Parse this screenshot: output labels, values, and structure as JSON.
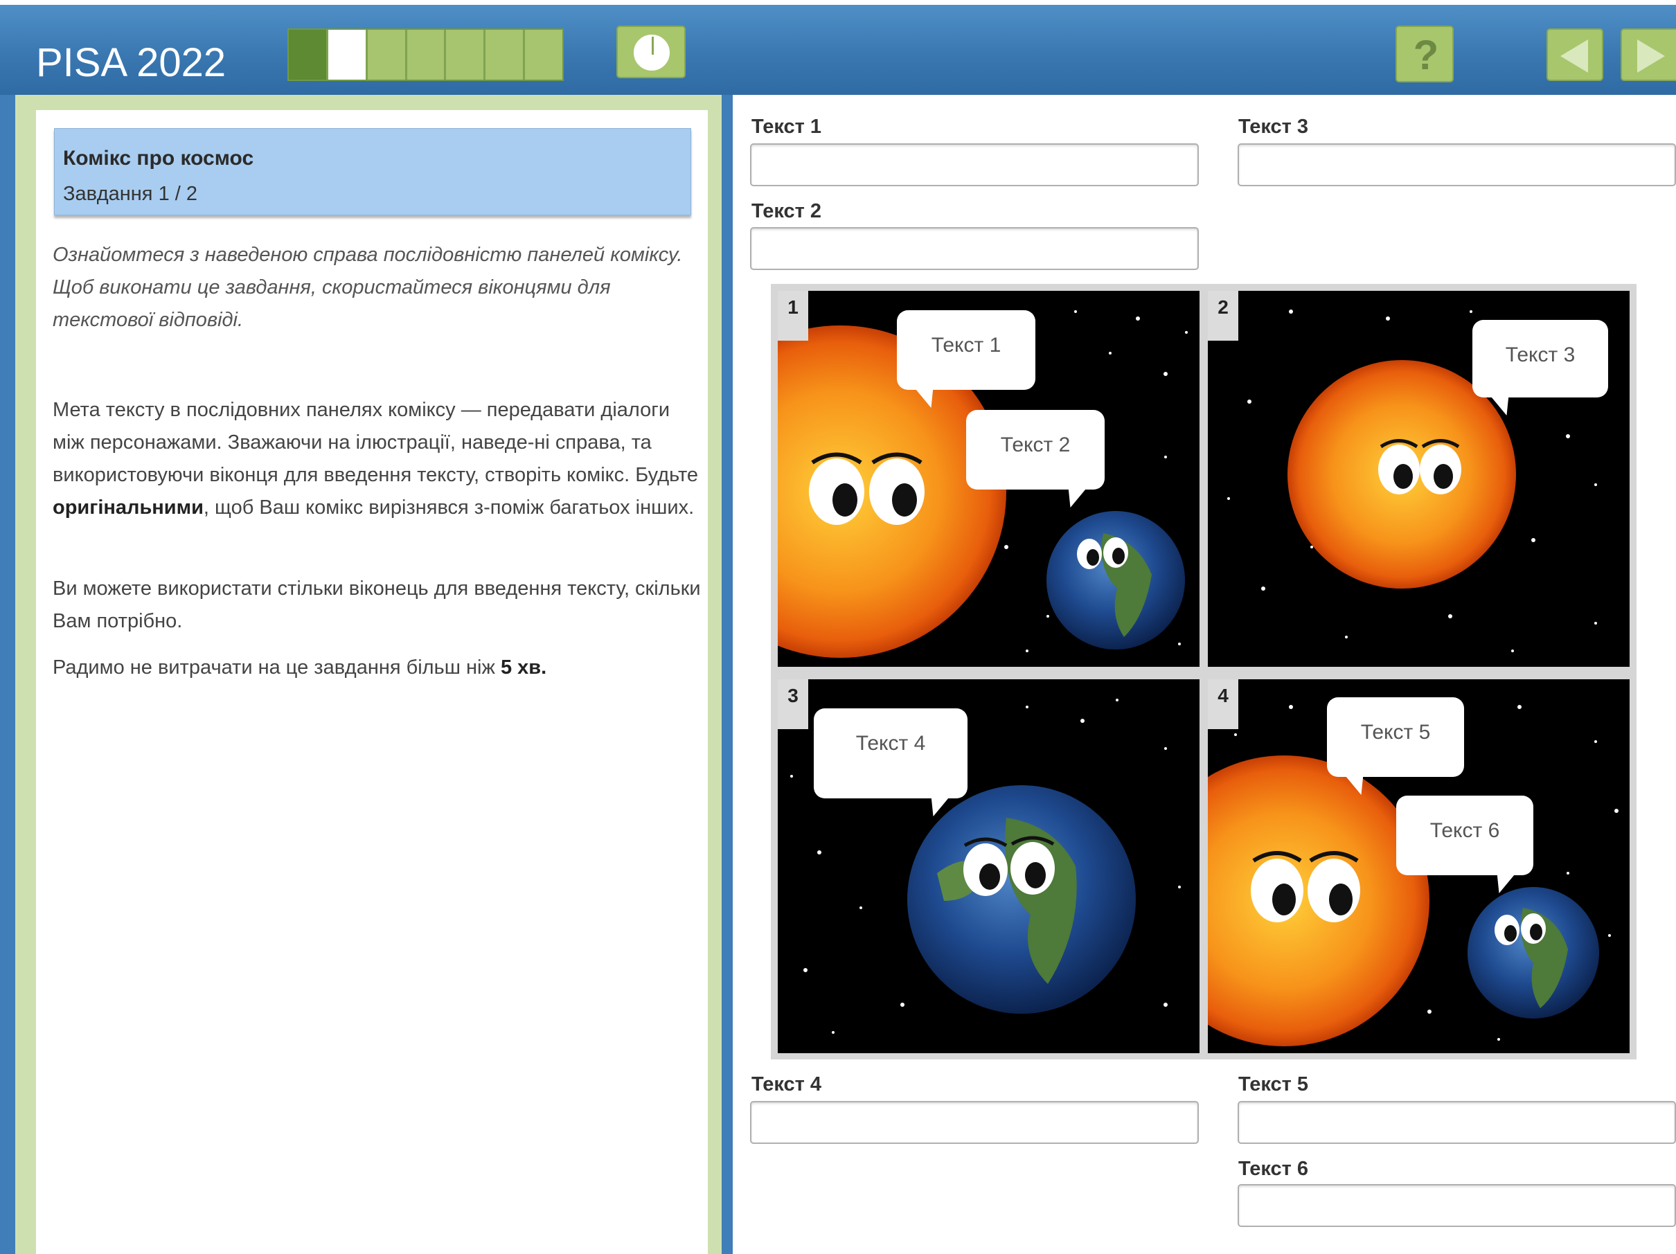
{
  "header": {
    "app_title": "PISA 2022",
    "progress": {
      "total_segments": 7,
      "current_segment": 2
    },
    "buttons": [
      "timer-icon",
      "help-icon",
      "back-arrow-icon",
      "forward-arrow-icon"
    ],
    "help_label": "?"
  },
  "task": {
    "title": "Комікс про космос",
    "counter": "Завдання 1 / 2",
    "intro": "Ознайомтеся з наведеною справа послідовністю панелей коміксу. Щоб виконати це завдання, скористайтеся віконцями для текстової відповіді.",
    "para1_before": "Мета тексту в послідовних панелях коміксу — передавати діалоги між персонажами. Зважаючи на ілюстрації, наведе-ні справа, та використовуючи віконця для введення тексту, створіть комікс. Будьте ",
    "para1_bold": "оригінальними",
    "para1_after": ", щоб Ваш комікс вирізнявся з-поміж багатьох інших.",
    "para2": "Ви можете використати стільки віконець для введення тексту, скільки Вам потрібно.",
    "para3_before": "Радимо не витрачати на це завдання більш ніж ",
    "para3_bold": "5 хв."
  },
  "fields": {
    "text1": "Текст 1",
    "text2": "Текст 2",
    "text3": "Текст 3",
    "text4": "Текст 4",
    "text5": "Текст 5",
    "text6": "Текст 6"
  },
  "comic": {
    "panel_numbers": [
      "1",
      "2",
      "3",
      "4"
    ],
    "bubbles": {
      "b1": "Текст 1",
      "b2": "Текст 2",
      "b3": "Текст 3",
      "b4": "Текст 4",
      "b5": "Текст 5",
      "b6": "Текст 6"
    }
  }
}
